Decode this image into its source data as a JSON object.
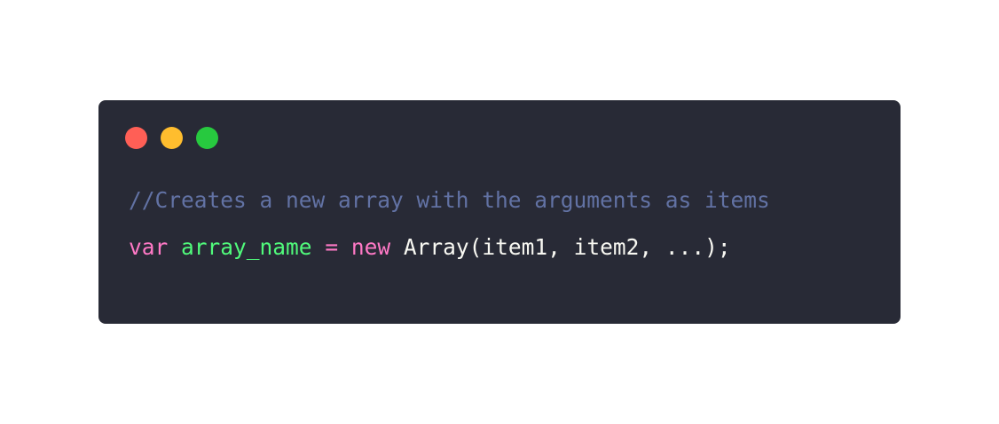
{
  "window_controls": {
    "close_color": "#ff5f56",
    "minimize_color": "#ffbd2e",
    "maximize_color": "#27c93f"
  },
  "code": {
    "language": "javascript",
    "line1": {
      "comment": "//Creates a new array with the arguments as items"
    },
    "line2": {
      "keyword_var": "var",
      "space1": " ",
      "identifier": "array_name",
      "space2": " ",
      "operator": "=",
      "space3": " ",
      "keyword_new": "new",
      "space4": " ",
      "rest": "Array(item1, item2, ...);"
    }
  },
  "colors": {
    "background": "#282a36",
    "comment": "#6272a4",
    "keyword": "#ff79c6",
    "identifier": "#50fa7b",
    "plain": "#f8f8f2"
  }
}
